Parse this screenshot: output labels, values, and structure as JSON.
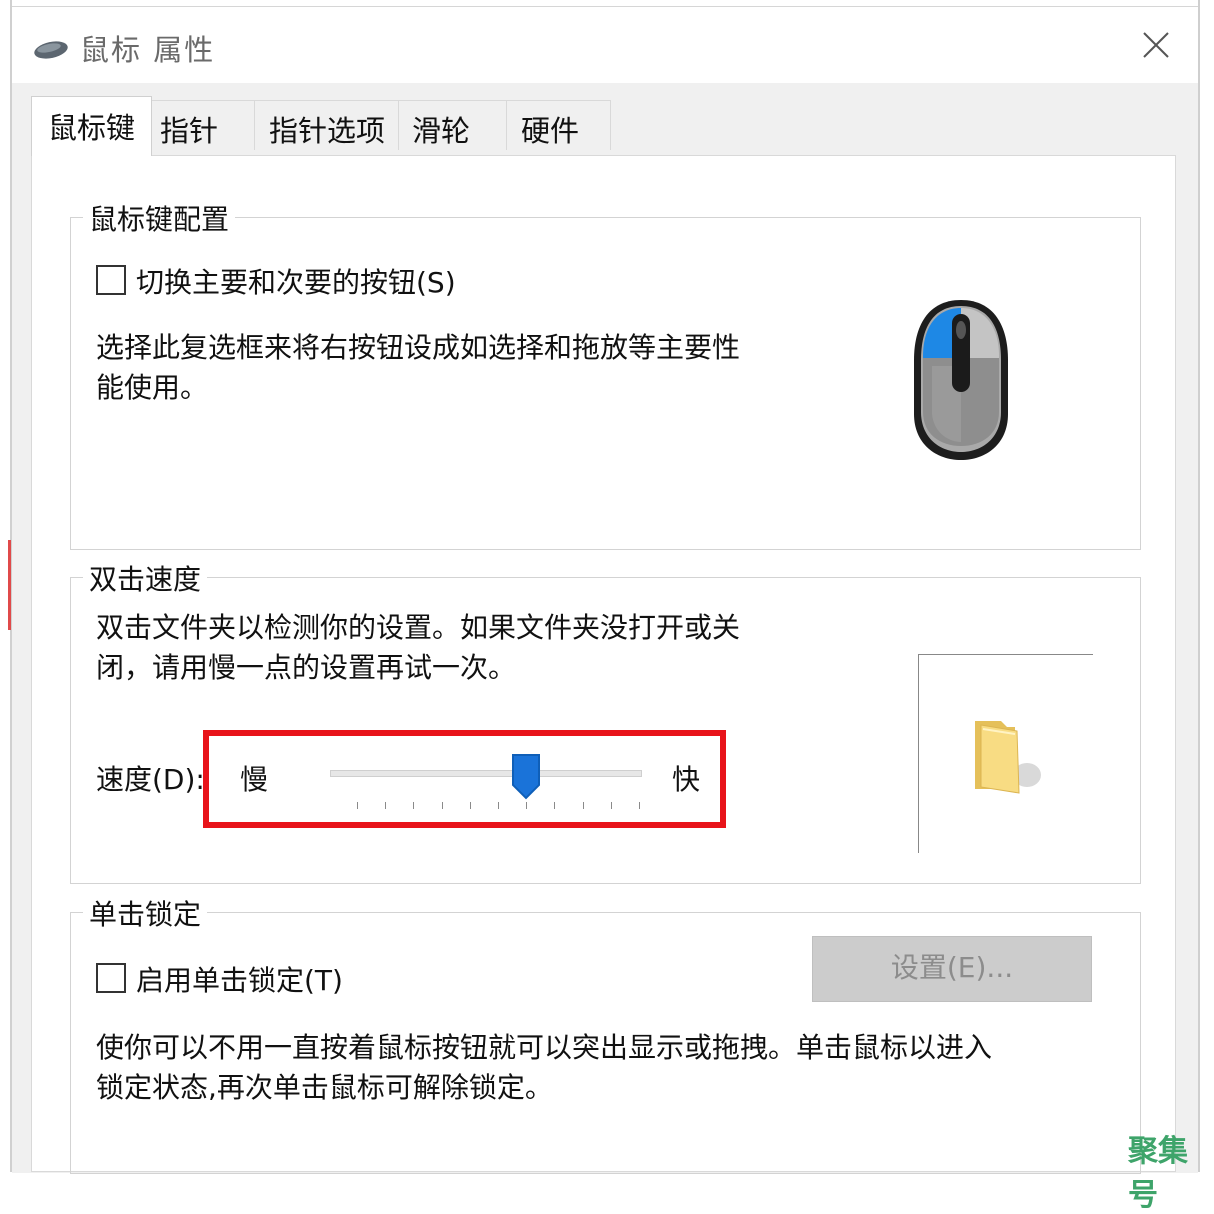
{
  "window": {
    "title": "鼠标 属性"
  },
  "tabs": [
    {
      "label": "鼠标键",
      "active": true
    },
    {
      "label": "指针"
    },
    {
      "label": "指针选项"
    },
    {
      "label": "滑轮"
    },
    {
      "label": "硬件"
    }
  ],
  "button_config": {
    "title": "鼠标键配置",
    "switch_checkbox_label": "切换主要和次要的按钮(S)",
    "switch_checked": false,
    "description_line1": "选择此复选框来将右按钮设成如选择和拖放等主要性",
    "description_line2": "能使用。"
  },
  "double_click": {
    "title": "双击速度",
    "description_line1": "双击文件夹以检测你的设置。如果文件夹没打开或关",
    "description_line2": "闭，请用慢一点的设置再试一次。",
    "speed_label": "速度(D):",
    "slow_label": "慢",
    "fast_label": "快",
    "speed_value": 6,
    "speed_max": 10
  },
  "click_lock": {
    "title": "单击锁定",
    "checkbox_label": "启用单击锁定(T)",
    "checked": false,
    "settings_button": "设置(E)...",
    "settings_enabled": false,
    "description_line1": "使你可以不用一直按着鼠标按钮就可以突出显示或拖拽。单击鼠标以进入",
    "description_line2": "锁定状态,再次单击鼠标可解除锁定。"
  },
  "watermark": "聚集号",
  "colors": {
    "highlight_box": "#e8141a",
    "mouse_primary_button": "#1e88e5",
    "slider_thumb": "#1a73d9",
    "watermark": "#3ea46a"
  }
}
